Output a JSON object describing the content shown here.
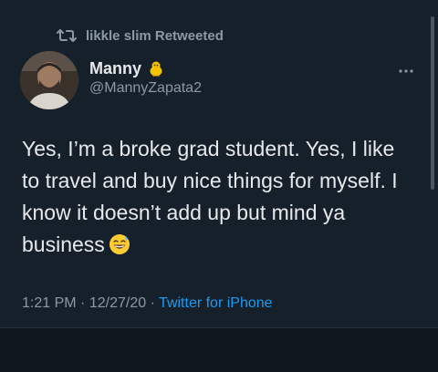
{
  "retweet": {
    "text": "likkle slim Retweeted"
  },
  "author": {
    "display_name": "Manny",
    "handle": "@MannyZapata2",
    "emoji_icon": "baby-chick-icon"
  },
  "tweet": {
    "text": "Yes, I’m a broke grad student. Yes, I like to travel and buy nice things for myself. I know it doesn’t add up but mind ya business",
    "emoji_icon": "grinning-sweat-face-icon"
  },
  "meta": {
    "time": "1:21 PM",
    "date": "12/27/20",
    "separator": "·",
    "source": "Twitter for iPhone"
  },
  "colors": {
    "background": "#15202b",
    "text": "#e7e9ea",
    "secondary": "#8b98a5",
    "link": "#1d9bf0"
  }
}
